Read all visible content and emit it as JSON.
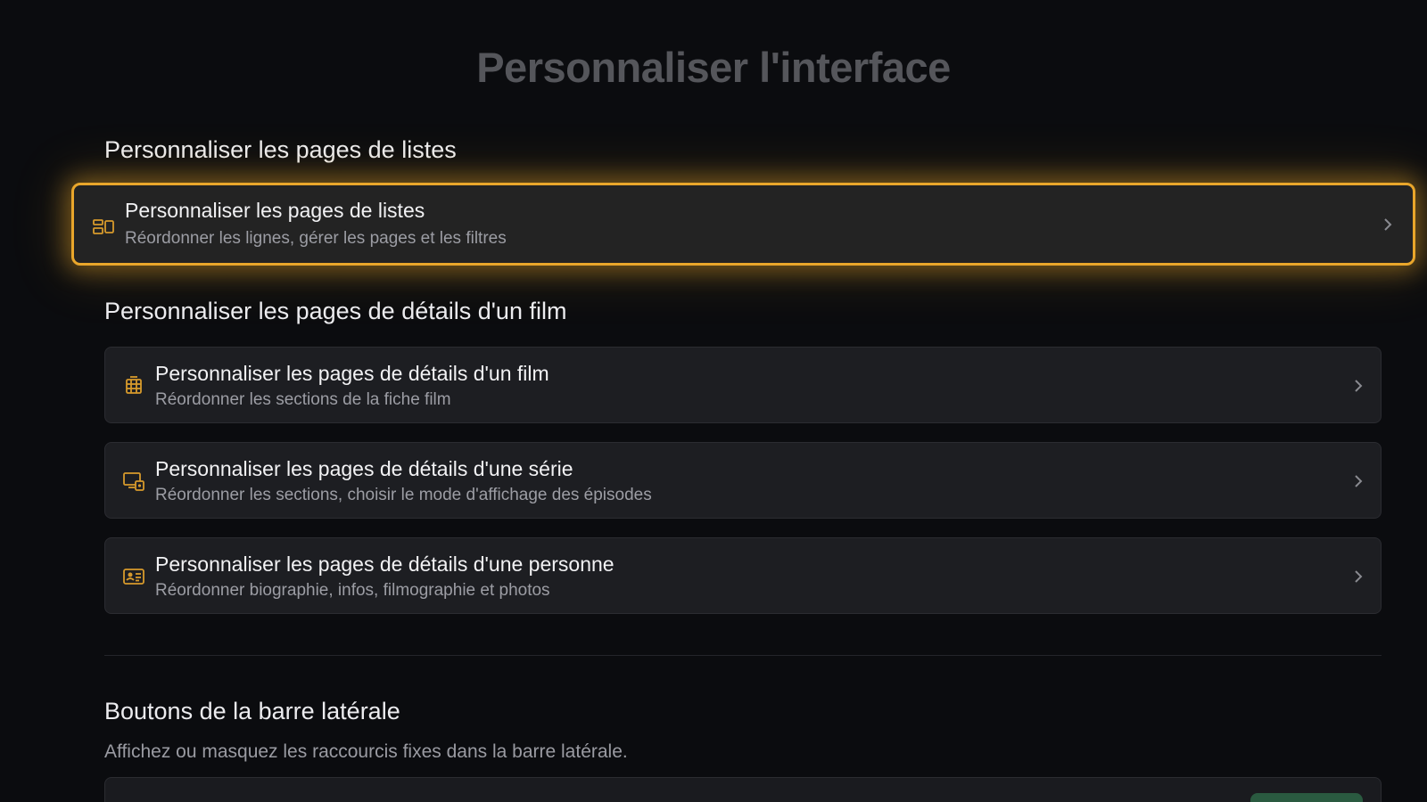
{
  "page": {
    "title": "Personnaliser l'interface"
  },
  "sections": {
    "lists": {
      "heading": "Personnaliser les pages de listes",
      "row": {
        "icon": "layout-grid-icon",
        "title": "Personnaliser les pages de listes",
        "subtitle": "Réordonner les lignes, gérer les pages et les filtres",
        "focused": true
      }
    },
    "details": {
      "heading": "Personnaliser les pages de détails d'un film",
      "rows": [
        {
          "icon": "film-icon",
          "title": "Personnaliser les pages de détails d'un film",
          "subtitle": "Réordonner les sections de la fiche film"
        },
        {
          "icon": "tv-series-icon",
          "title": "Personnaliser les pages de détails d'une série",
          "subtitle": "Réordonner les sections, choisir le mode d'affichage des épisodes"
        },
        {
          "icon": "person-card-icon",
          "title": "Personnaliser les pages de détails d'une personne",
          "subtitle": "Réordonner biographie, infos, filmographie et photos"
        }
      ]
    },
    "sidebar": {
      "heading": "Boutons de la barre latérale",
      "description": "Affichez ou masquez les raccourcis fixes dans la barre latérale."
    }
  },
  "colors": {
    "accent": "#e9a62b",
    "icon": "#d79a2c",
    "background": "#0b0c0f",
    "card": "#1d1e22",
    "toggle_on": "#2a5a40"
  }
}
